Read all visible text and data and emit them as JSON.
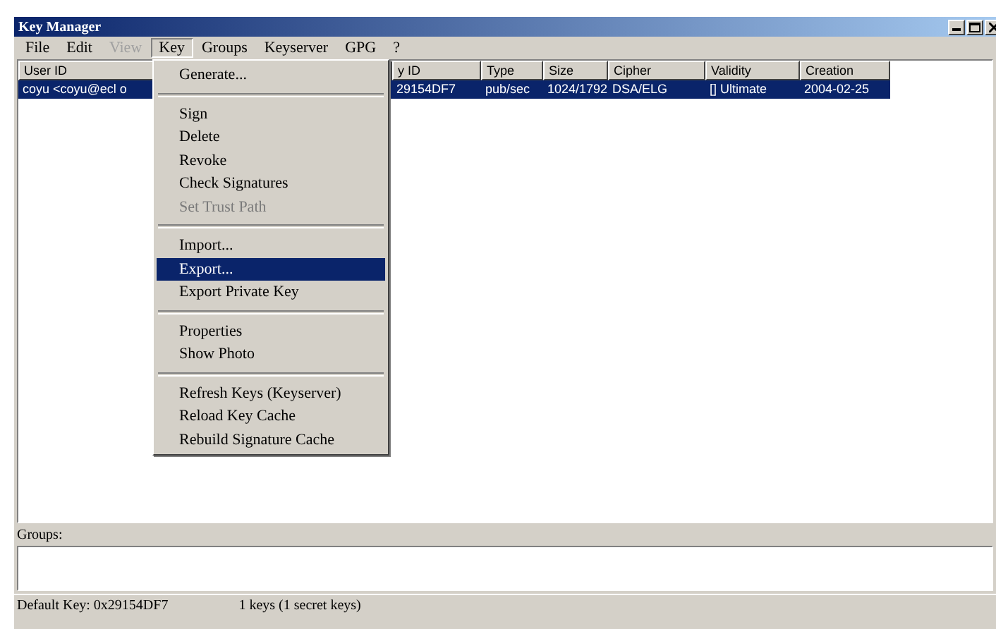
{
  "window": {
    "title": "Key Manager"
  },
  "menu_bar": [
    {
      "label": "File",
      "selected": false,
      "disabled": false
    },
    {
      "label": "Edit",
      "selected": false,
      "disabled": false
    },
    {
      "label": "View",
      "selected": false,
      "disabled": true
    },
    {
      "label": "Key",
      "selected": true,
      "disabled": false
    },
    {
      "label": "Groups",
      "selected": false,
      "disabled": false
    },
    {
      "label": "Keyserver",
      "selected": false,
      "disabled": false
    },
    {
      "label": "GPG",
      "selected": false,
      "disabled": false
    },
    {
      "label": "?",
      "selected": false,
      "disabled": false
    }
  ],
  "key_menu": [
    {
      "kind": "item",
      "label": "Generate...",
      "disabled": false,
      "selected": false
    },
    {
      "kind": "separator"
    },
    {
      "kind": "item",
      "label": "Sign",
      "disabled": false,
      "selected": false
    },
    {
      "kind": "item",
      "label": "Delete",
      "disabled": false,
      "selected": false
    },
    {
      "kind": "item",
      "label": "Revoke",
      "disabled": false,
      "selected": false
    },
    {
      "kind": "item",
      "label": "Check Signatures",
      "disabled": false,
      "selected": false
    },
    {
      "kind": "item",
      "label": "Set Trust Path",
      "disabled": true,
      "selected": false
    },
    {
      "kind": "separator"
    },
    {
      "kind": "item",
      "label": "Import...",
      "disabled": false,
      "selected": false
    },
    {
      "kind": "item",
      "label": "Export...",
      "disabled": false,
      "selected": true
    },
    {
      "kind": "item",
      "label": "Export Private Key",
      "disabled": false,
      "selected": false
    },
    {
      "kind": "separator"
    },
    {
      "kind": "item",
      "label": "Properties",
      "disabled": false,
      "selected": false
    },
    {
      "kind": "item",
      "label": "Show Photo",
      "disabled": false,
      "selected": false
    },
    {
      "kind": "separator"
    },
    {
      "kind": "item",
      "label": "Refresh Keys (Keyserver)",
      "disabled": false,
      "selected": false
    },
    {
      "kind": "item",
      "label": "Reload Key Cache",
      "disabled": false,
      "selected": false
    },
    {
      "kind": "item",
      "label": "Rebuild Signature Cache",
      "disabled": false,
      "selected": false
    }
  ],
  "table": {
    "columns": [
      "User ID",
      "y ID",
      "Type",
      "Size",
      "Cipher",
      "Validity",
      "Creation"
    ],
    "rows": [
      {
        "selected": true,
        "cells": [
          "coyu <coyu@ecl o",
          "29154DF7",
          "pub/sec",
          "1024/1792",
          "DSA/ELG",
          "[] Ultimate",
          "2004-02-25"
        ]
      }
    ]
  },
  "groups": {
    "label": "Groups:"
  },
  "status_bar": [
    "Default Key: 0x29154DF7",
    "1 keys (1 secret keys)"
  ]
}
